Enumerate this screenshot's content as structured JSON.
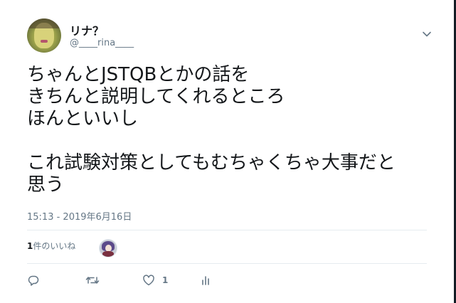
{
  "user": {
    "display_name": "リナ？",
    "handle": "@____rina____"
  },
  "tweet": {
    "text": "ちゃんとJSTQBとかの話を\nきちんと説明してくれるところ\nほんといいし\n\nこれ試験対策としてもむちゃくちゃ大事だと\n思う",
    "timestamp": "15:13 - 2019年6月16日"
  },
  "stats": {
    "like_count": "1",
    "like_label": "件のいいね"
  },
  "actions": {
    "like_count": "1"
  },
  "colors": {
    "text": "#14171a",
    "secondary": "#657786",
    "divider": "#e6ecf0"
  }
}
